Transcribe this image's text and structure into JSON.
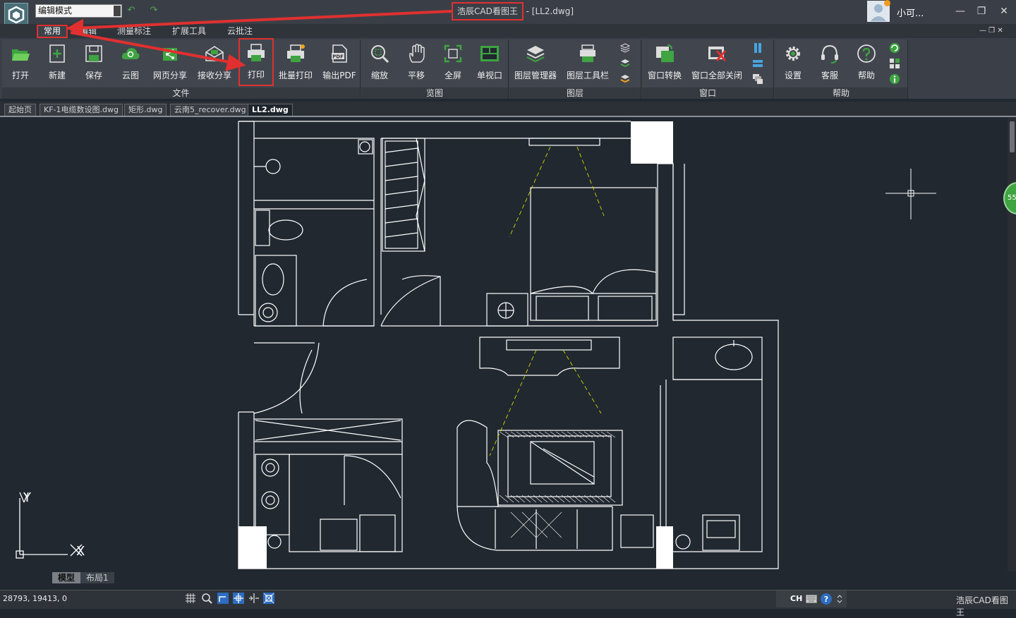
{
  "app": {
    "title_highlight": "浩辰CAD看图王",
    "title_suffix": " - [LL2.dwg]",
    "mode": "编辑模式",
    "user": "小可..."
  },
  "window_controls": {
    "minimize": "—",
    "restore": "❐",
    "close": "✕"
  },
  "menu": [
    "常用",
    "编辑",
    "测量标注",
    "扩展工具",
    "云批注"
  ],
  "ribbon": {
    "groups": [
      {
        "label": "文件",
        "buttons": [
          "打开",
          "新建",
          "保存",
          "云图",
          "网页分享",
          "接收分享",
          "打印",
          "批量打印",
          "输出PDF"
        ]
      },
      {
        "label": "览图",
        "buttons": [
          "缩放",
          "平移",
          "全屏",
          "单视口"
        ]
      },
      {
        "label": "图层",
        "buttons": [
          "图层管理器",
          "图层工具栏"
        ]
      },
      {
        "label": "窗口",
        "buttons": [
          "窗口转换",
          "窗口全部关闭"
        ]
      },
      {
        "label": "帮助",
        "buttons": [
          "设置",
          "客服",
          "帮助"
        ]
      }
    ],
    "pdf_badge": "PDF"
  },
  "doc_tabs": [
    "起始页",
    "KF-1电缆数设图.dwg",
    "矩形.dwg",
    "云南5_recover.dwg",
    "LL2.dwg"
  ],
  "active_doc_tab": "LL2.dwg",
  "canvas": {
    "axis_x": "X",
    "axis_y": "Y",
    "side_badge": "55"
  },
  "layout_tabs": [
    "模型",
    "布局1"
  ],
  "status": {
    "coords": "28793, 19413, 0",
    "ime": "CH",
    "brand": "浩辰CAD看图王"
  },
  "colors": {
    "accent_red": "#e03030",
    "icon_green": "#3fa441",
    "cad_line": "#ffffff",
    "cad_light": "#d4d800"
  }
}
